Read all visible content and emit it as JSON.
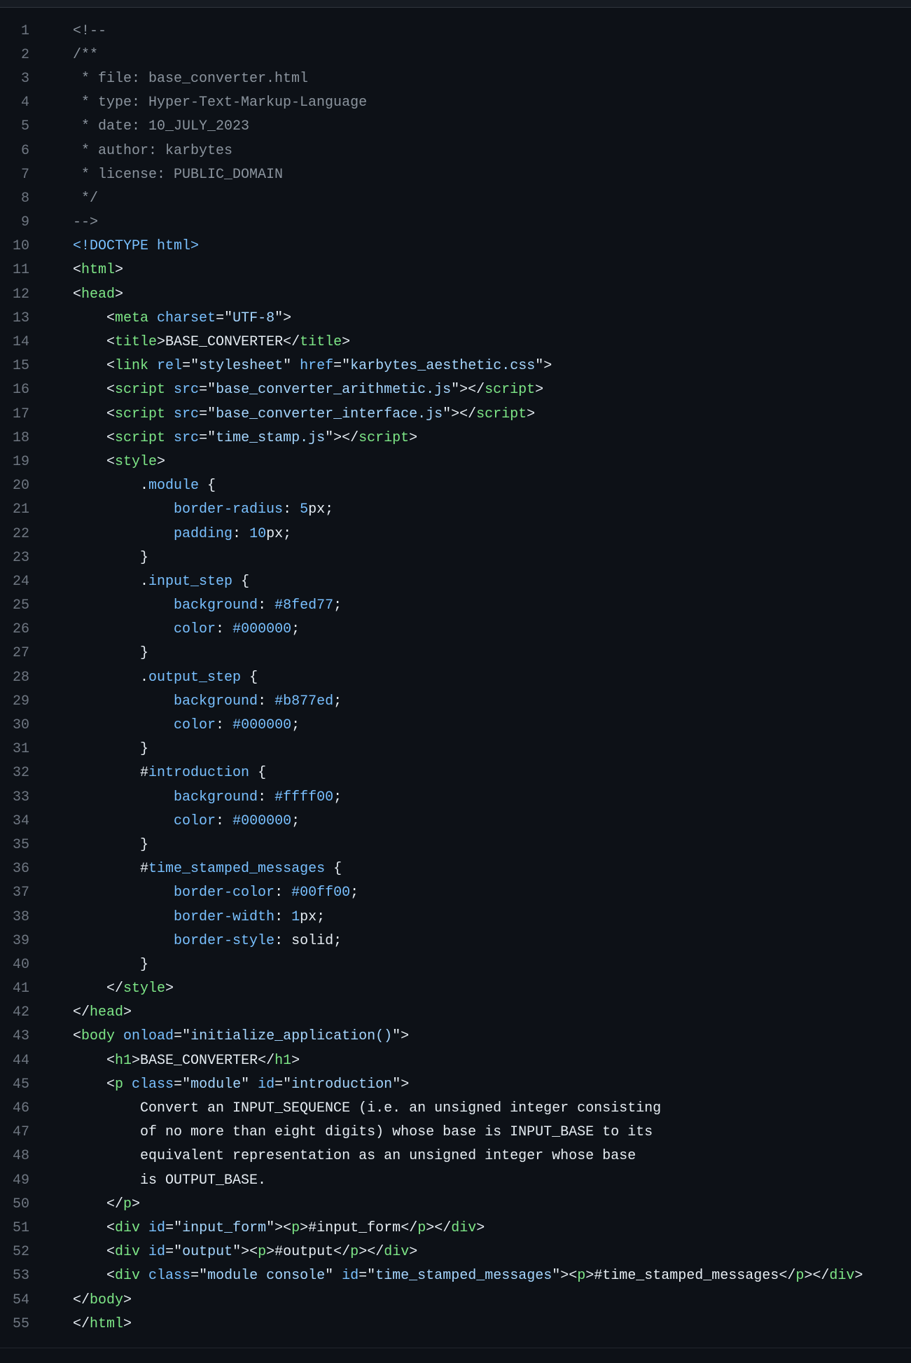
{
  "colors": {
    "background": "#0d1117",
    "line_number": "#6e7681",
    "comment": "#8b949e",
    "tag": "#7ee787",
    "attribute": "#79c0ff",
    "string": "#a5d6ff",
    "text": "#e6edf3"
  },
  "lines": [
    {
      "n": "1",
      "tokens": [
        [
          "comment",
          "<!--"
        ]
      ]
    },
    {
      "n": "2",
      "tokens": [
        [
          "comment",
          "/**"
        ]
      ]
    },
    {
      "n": "3",
      "tokens": [
        [
          "comment",
          " * file: base_converter.html"
        ]
      ]
    },
    {
      "n": "4",
      "tokens": [
        [
          "comment",
          " * type: Hyper-Text-Markup-Language"
        ]
      ]
    },
    {
      "n": "5",
      "tokens": [
        [
          "comment",
          " * date: 10_JULY_2023"
        ]
      ]
    },
    {
      "n": "6",
      "tokens": [
        [
          "comment",
          " * author: karbytes"
        ]
      ]
    },
    {
      "n": "7",
      "tokens": [
        [
          "comment",
          " * license: PUBLIC_DOMAIN"
        ]
      ]
    },
    {
      "n": "8",
      "tokens": [
        [
          "comment",
          " */"
        ]
      ]
    },
    {
      "n": "9",
      "tokens": [
        [
          "comment",
          "-->"
        ]
      ]
    },
    {
      "n": "10",
      "tokens": [
        [
          "doctype",
          "<!DOCTYPE html>"
        ]
      ]
    },
    {
      "n": "11",
      "tokens": [
        [
          "punc",
          "<"
        ],
        [
          "tag",
          "html"
        ],
        [
          "punc",
          ">"
        ]
      ]
    },
    {
      "n": "12",
      "tokens": [
        [
          "punc",
          "<"
        ],
        [
          "tag",
          "head"
        ],
        [
          "punc",
          ">"
        ]
      ]
    },
    {
      "n": "13",
      "tokens": [
        [
          "punc",
          "    <"
        ],
        [
          "tag",
          "meta"
        ],
        [
          "text",
          " "
        ],
        [
          "attr",
          "charset"
        ],
        [
          "punc",
          "="
        ],
        [
          "punc",
          "\""
        ],
        [
          "str",
          "UTF-8"
        ],
        [
          "punc",
          "\">"
        ]
      ]
    },
    {
      "n": "14",
      "tokens": [
        [
          "punc",
          "    <"
        ],
        [
          "tag",
          "title"
        ],
        [
          "punc",
          ">"
        ],
        [
          "text",
          "BASE_CONVERTER"
        ],
        [
          "punc",
          "</"
        ],
        [
          "tag",
          "title"
        ],
        [
          "punc",
          ">"
        ]
      ]
    },
    {
      "n": "15",
      "tokens": [
        [
          "punc",
          "    <"
        ],
        [
          "tag",
          "link"
        ],
        [
          "text",
          " "
        ],
        [
          "attr",
          "rel"
        ],
        [
          "punc",
          "=\""
        ],
        [
          "str",
          "stylesheet"
        ],
        [
          "punc",
          "\""
        ],
        [
          "text",
          " "
        ],
        [
          "attr",
          "href"
        ],
        [
          "punc",
          "=\""
        ],
        [
          "str",
          "karbytes_aesthetic.css"
        ],
        [
          "punc",
          "\">"
        ]
      ]
    },
    {
      "n": "16",
      "tokens": [
        [
          "punc",
          "    <"
        ],
        [
          "tag",
          "script"
        ],
        [
          "text",
          " "
        ],
        [
          "attr",
          "src"
        ],
        [
          "punc",
          "=\""
        ],
        [
          "str",
          "base_converter_arithmetic.js"
        ],
        [
          "punc",
          "\"></"
        ],
        [
          "tag",
          "script"
        ],
        [
          "punc",
          ">"
        ]
      ]
    },
    {
      "n": "17",
      "tokens": [
        [
          "punc",
          "    <"
        ],
        [
          "tag",
          "script"
        ],
        [
          "text",
          " "
        ],
        [
          "attr",
          "src"
        ],
        [
          "punc",
          "=\""
        ],
        [
          "str",
          "base_converter_interface.js"
        ],
        [
          "punc",
          "\"></"
        ],
        [
          "tag",
          "script"
        ],
        [
          "punc",
          ">"
        ]
      ]
    },
    {
      "n": "18",
      "tokens": [
        [
          "punc",
          "    <"
        ],
        [
          "tag",
          "script"
        ],
        [
          "text",
          " "
        ],
        [
          "attr",
          "src"
        ],
        [
          "punc",
          "=\""
        ],
        [
          "str",
          "time_stamp.js"
        ],
        [
          "punc",
          "\"></"
        ],
        [
          "tag",
          "script"
        ],
        [
          "punc",
          ">"
        ]
      ]
    },
    {
      "n": "19",
      "tokens": [
        [
          "punc",
          "    <"
        ],
        [
          "tag",
          "style"
        ],
        [
          "punc",
          ">"
        ]
      ]
    },
    {
      "n": "20",
      "tokens": [
        [
          "punc",
          "        ."
        ],
        [
          "sel",
          "module"
        ],
        [
          "punc",
          " {"
        ]
      ]
    },
    {
      "n": "21",
      "tokens": [
        [
          "text",
          "            "
        ],
        [
          "prop",
          "border-radius"
        ],
        [
          "punc",
          ": "
        ],
        [
          "num",
          "5"
        ],
        [
          "text",
          "px;"
        ]
      ]
    },
    {
      "n": "22",
      "tokens": [
        [
          "text",
          "            "
        ],
        [
          "prop",
          "padding"
        ],
        [
          "punc",
          ": "
        ],
        [
          "num",
          "10"
        ],
        [
          "text",
          "px;"
        ]
      ]
    },
    {
      "n": "23",
      "tokens": [
        [
          "punc",
          "        }"
        ]
      ]
    },
    {
      "n": "24",
      "tokens": [
        [
          "punc",
          "        ."
        ],
        [
          "sel",
          "input_step"
        ],
        [
          "punc",
          " {"
        ]
      ]
    },
    {
      "n": "25",
      "tokens": [
        [
          "text",
          "            "
        ],
        [
          "prop",
          "background"
        ],
        [
          "punc",
          ": "
        ],
        [
          "num",
          "#8fed77"
        ],
        [
          "punc",
          ";"
        ]
      ]
    },
    {
      "n": "26",
      "tokens": [
        [
          "text",
          "            "
        ],
        [
          "prop",
          "color"
        ],
        [
          "punc",
          ": "
        ],
        [
          "num",
          "#000000"
        ],
        [
          "punc",
          ";"
        ]
      ]
    },
    {
      "n": "27",
      "tokens": [
        [
          "punc",
          "        }"
        ]
      ]
    },
    {
      "n": "28",
      "tokens": [
        [
          "punc",
          "        ."
        ],
        [
          "sel",
          "output_step"
        ],
        [
          "punc",
          " {"
        ]
      ]
    },
    {
      "n": "29",
      "tokens": [
        [
          "text",
          "            "
        ],
        [
          "prop",
          "background"
        ],
        [
          "punc",
          ": "
        ],
        [
          "num",
          "#b877ed"
        ],
        [
          "punc",
          ";"
        ]
      ]
    },
    {
      "n": "30",
      "tokens": [
        [
          "text",
          "            "
        ],
        [
          "prop",
          "color"
        ],
        [
          "punc",
          ": "
        ],
        [
          "num",
          "#000000"
        ],
        [
          "punc",
          ";"
        ]
      ]
    },
    {
      "n": "31",
      "tokens": [
        [
          "punc",
          "        }"
        ]
      ]
    },
    {
      "n": "32",
      "tokens": [
        [
          "punc",
          "        #"
        ],
        [
          "sel",
          "introduction"
        ],
        [
          "punc",
          " {"
        ]
      ]
    },
    {
      "n": "33",
      "tokens": [
        [
          "text",
          "            "
        ],
        [
          "prop",
          "background"
        ],
        [
          "punc",
          ": "
        ],
        [
          "num",
          "#ffff00"
        ],
        [
          "punc",
          ";"
        ]
      ]
    },
    {
      "n": "34",
      "tokens": [
        [
          "text",
          "            "
        ],
        [
          "prop",
          "color"
        ],
        [
          "punc",
          ": "
        ],
        [
          "num",
          "#000000"
        ],
        [
          "punc",
          ";"
        ]
      ]
    },
    {
      "n": "35",
      "tokens": [
        [
          "punc",
          "        }"
        ]
      ]
    },
    {
      "n": "36",
      "tokens": [
        [
          "punc",
          "        #"
        ],
        [
          "sel",
          "time_stamped_messages"
        ],
        [
          "punc",
          " {"
        ]
      ]
    },
    {
      "n": "37",
      "tokens": [
        [
          "text",
          "            "
        ],
        [
          "prop",
          "border-color"
        ],
        [
          "punc",
          ": "
        ],
        [
          "num",
          "#00ff00"
        ],
        [
          "punc",
          ";"
        ]
      ]
    },
    {
      "n": "38",
      "tokens": [
        [
          "text",
          "            "
        ],
        [
          "prop",
          "border-width"
        ],
        [
          "punc",
          ": "
        ],
        [
          "num",
          "1"
        ],
        [
          "text",
          "px;"
        ]
      ]
    },
    {
      "n": "39",
      "tokens": [
        [
          "text",
          "            "
        ],
        [
          "prop",
          "border-style"
        ],
        [
          "punc",
          ": "
        ],
        [
          "text",
          "solid;"
        ]
      ]
    },
    {
      "n": "40",
      "tokens": [
        [
          "punc",
          "        }"
        ]
      ]
    },
    {
      "n": "41",
      "tokens": [
        [
          "punc",
          "    </"
        ],
        [
          "tag",
          "style"
        ],
        [
          "punc",
          ">"
        ]
      ]
    },
    {
      "n": "42",
      "tokens": [
        [
          "punc",
          "</"
        ],
        [
          "tag",
          "head"
        ],
        [
          "punc",
          ">"
        ]
      ]
    },
    {
      "n": "43",
      "tokens": [
        [
          "punc",
          "<"
        ],
        [
          "tag",
          "body"
        ],
        [
          "text",
          " "
        ],
        [
          "attr",
          "onload"
        ],
        [
          "punc",
          "=\""
        ],
        [
          "str",
          "initialize_application()"
        ],
        [
          "punc",
          "\">"
        ]
      ]
    },
    {
      "n": "44",
      "tokens": [
        [
          "punc",
          "    <"
        ],
        [
          "tag",
          "h1"
        ],
        [
          "punc",
          ">"
        ],
        [
          "text",
          "BASE_CONVERTER"
        ],
        [
          "punc",
          "</"
        ],
        [
          "tag",
          "h1"
        ],
        [
          "punc",
          ">"
        ]
      ]
    },
    {
      "n": "45",
      "tokens": [
        [
          "punc",
          "    <"
        ],
        [
          "tag",
          "p"
        ],
        [
          "text",
          " "
        ],
        [
          "attr",
          "class"
        ],
        [
          "punc",
          "=\""
        ],
        [
          "str",
          "module"
        ],
        [
          "punc",
          "\""
        ],
        [
          "text",
          " "
        ],
        [
          "attr",
          "id"
        ],
        [
          "punc",
          "=\""
        ],
        [
          "str",
          "introduction"
        ],
        [
          "punc",
          "\">"
        ]
      ]
    },
    {
      "n": "46",
      "tokens": [
        [
          "text",
          "        Convert an INPUT_SEQUENCE (i.e. an unsigned integer consisting"
        ]
      ]
    },
    {
      "n": "47",
      "tokens": [
        [
          "text",
          "        of no more than eight digits) whose base is INPUT_BASE to its"
        ]
      ]
    },
    {
      "n": "48",
      "tokens": [
        [
          "text",
          "        equivalent representation as an unsigned integer whose base"
        ]
      ]
    },
    {
      "n": "49",
      "tokens": [
        [
          "text",
          "        is OUTPUT_BASE."
        ]
      ]
    },
    {
      "n": "50",
      "tokens": [
        [
          "punc",
          "    </"
        ],
        [
          "tag",
          "p"
        ],
        [
          "punc",
          ">"
        ]
      ]
    },
    {
      "n": "51",
      "tokens": [
        [
          "punc",
          "    <"
        ],
        [
          "tag",
          "div"
        ],
        [
          "text",
          " "
        ],
        [
          "attr",
          "id"
        ],
        [
          "punc",
          "=\""
        ],
        [
          "str",
          "input_form"
        ],
        [
          "punc",
          "\"><"
        ],
        [
          "tag",
          "p"
        ],
        [
          "punc",
          ">"
        ],
        [
          "text",
          "#input_form"
        ],
        [
          "punc",
          "</"
        ],
        [
          "tag",
          "p"
        ],
        [
          "punc",
          "></"
        ],
        [
          "tag",
          "div"
        ],
        [
          "punc",
          ">"
        ]
      ]
    },
    {
      "n": "52",
      "tokens": [
        [
          "punc",
          "    <"
        ],
        [
          "tag",
          "div"
        ],
        [
          "text",
          " "
        ],
        [
          "attr",
          "id"
        ],
        [
          "punc",
          "=\""
        ],
        [
          "str",
          "output"
        ],
        [
          "punc",
          "\"><"
        ],
        [
          "tag",
          "p"
        ],
        [
          "punc",
          ">"
        ],
        [
          "text",
          "#output"
        ],
        [
          "punc",
          "</"
        ],
        [
          "tag",
          "p"
        ],
        [
          "punc",
          "></"
        ],
        [
          "tag",
          "div"
        ],
        [
          "punc",
          ">"
        ]
      ]
    },
    {
      "n": "53",
      "tokens": [
        [
          "punc",
          "    <"
        ],
        [
          "tag",
          "div"
        ],
        [
          "text",
          " "
        ],
        [
          "attr",
          "class"
        ],
        [
          "punc",
          "=\""
        ],
        [
          "str",
          "module console"
        ],
        [
          "punc",
          "\""
        ],
        [
          "text",
          " "
        ],
        [
          "attr",
          "id"
        ],
        [
          "punc",
          "=\""
        ],
        [
          "str",
          "time_stamped_messages"
        ],
        [
          "punc",
          "\"><"
        ],
        [
          "tag",
          "p"
        ],
        [
          "punc",
          ">"
        ],
        [
          "text",
          "#time_stamped_messages"
        ],
        [
          "punc",
          "</"
        ],
        [
          "tag",
          "p"
        ],
        [
          "punc",
          "></"
        ],
        [
          "tag",
          "div"
        ],
        [
          "punc",
          ">"
        ]
      ]
    },
    {
      "n": "54",
      "tokens": [
        [
          "punc",
          "</"
        ],
        [
          "tag",
          "body"
        ],
        [
          "punc",
          ">"
        ]
      ]
    },
    {
      "n": "55",
      "tokens": [
        [
          "punc",
          "</"
        ],
        [
          "tag",
          "html"
        ],
        [
          "punc",
          ">"
        ]
      ]
    }
  ]
}
